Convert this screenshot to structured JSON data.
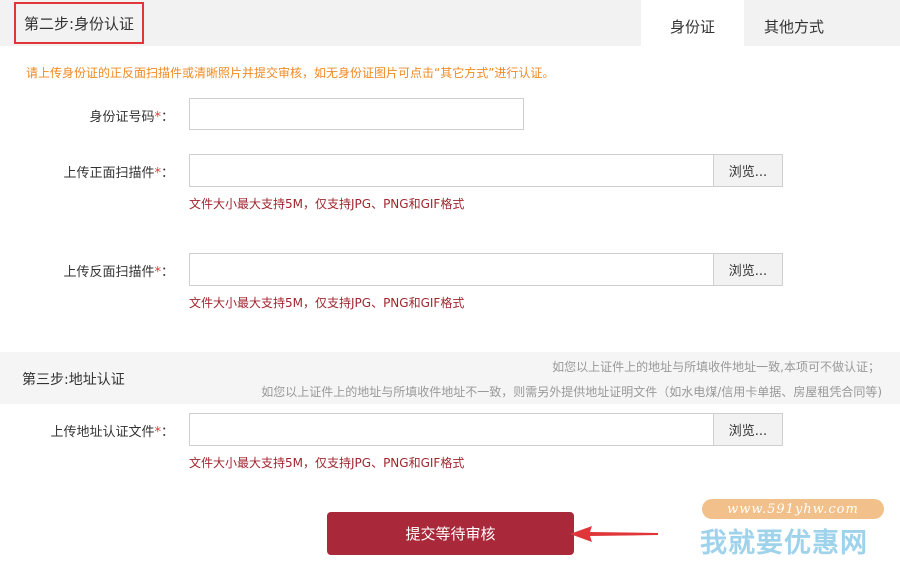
{
  "step2": {
    "title": "第二步:身份认证",
    "tabs": [
      {
        "label": "身份证"
      },
      {
        "label": "其他方式"
      }
    ],
    "notice": "请上传身份证的正反面扫描件或清晰照片并提交审核，如无身份证图片可点击“其它方式”进行认证。",
    "id_number": {
      "label": "身份证号码",
      "required": "*",
      "colon": "：",
      "value": ""
    },
    "front_upload": {
      "label": "上传正面扫描件",
      "required": "*",
      "colon": "：",
      "browse": "浏览...",
      "hint": "文件大小最大支持5M，仅支持JPG、PNG和GIF格式"
    },
    "back_upload": {
      "label": "上传反面扫描件",
      "required": "*",
      "colon": "：",
      "browse": "浏览...",
      "hint": "文件大小最大支持5M，仅支持JPG、PNG和GIF格式"
    }
  },
  "step3": {
    "title": "第三步:地址认证",
    "note1": "如您以上证件上的地址与所填收件地址一致,本项可不做认证；",
    "note2": "如您以上证件上的地址与所填收件地址不一致，则需另外提供地址证明文件（如水电煤/信用卡单据、房屋租凭合同等)",
    "address_upload": {
      "label": "上传地址认证文件",
      "required": "*",
      "colon": "：",
      "browse": "浏览...",
      "hint": "文件大小最大支持5M，仅支持JPG、PNG和GIF格式"
    }
  },
  "submit_label": "提交等待审核",
  "watermark": {
    "url": "www.591yhw.com",
    "text": "我就要优惠网"
  },
  "colors": {
    "accent": "#a9283a",
    "notice": "#f08a24",
    "highlight_box": "#e0363a",
    "hint": "#a0262e"
  }
}
